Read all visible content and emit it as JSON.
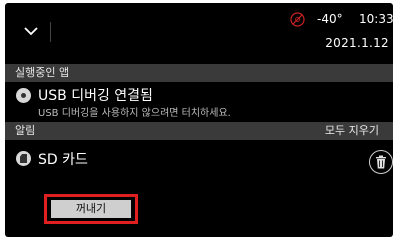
{
  "status_bar": {
    "temperature": "-40°",
    "time": "10:33",
    "date": "2021.1.12"
  },
  "running_apps": {
    "header": "실행중인 앱",
    "items": [
      {
        "title": "USB 디버깅 연결됨",
        "subtitle": "USB 디버깅을 사용하지 않으려면 터치하세요."
      }
    ]
  },
  "alarms": {
    "header": "알림",
    "clear_all": "모두 지우기",
    "items": [
      {
        "title": "SD 카드",
        "action": "꺼내기"
      }
    ]
  },
  "colors": {
    "background": "#000000",
    "section_header": "#3a3a3a",
    "highlight": "#e02020",
    "no_signal_icon": "#cc2222"
  },
  "icons": {
    "collapse": "chevron-down-icon",
    "no_signal": "no-signal-icon",
    "usb": "usb-debug-icon",
    "sd": "sd-card-icon",
    "delete": "trash-icon"
  }
}
